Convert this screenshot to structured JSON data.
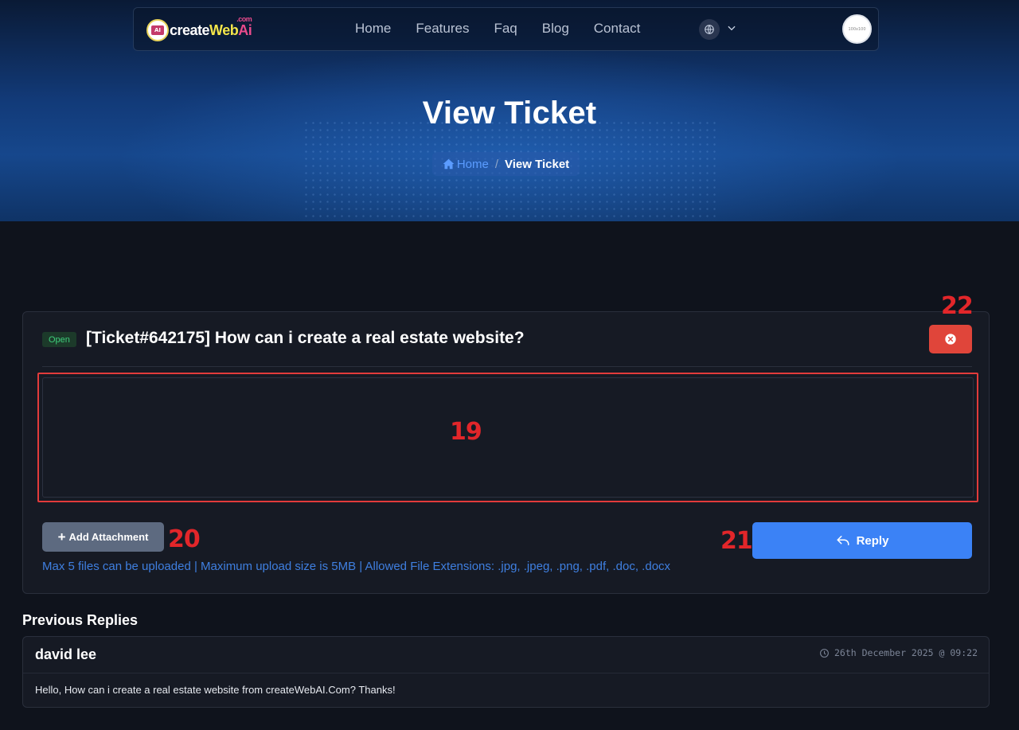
{
  "navbar": {
    "logo": {
      "main": "create",
      "accent": "Web",
      "suffix": "Ai",
      "tld": ".com",
      "badge": "AI"
    },
    "links": [
      "Home",
      "Features",
      "Faq",
      "Blog",
      "Contact"
    ],
    "language_icon": "globe-icon",
    "avatar_text": "100x100"
  },
  "hero": {
    "title": "View Ticket",
    "breadcrumb": {
      "home": "Home",
      "separator": "/",
      "current": "View Ticket"
    }
  },
  "ticket": {
    "status": "Open",
    "title": "[Ticket#642175] How can i create a real estate website?",
    "editor_value": "",
    "add_attachment_label": "Add Attachment",
    "reply_label": "Reply",
    "upload_hint": "Max 5 files can be uploaded | Maximum upload size is 5MB | Allowed File Extensions: .jpg, .jpeg, .png, .pdf, .doc, .docx"
  },
  "annotations": {
    "editor": "19",
    "attach": "20",
    "reply": "21",
    "close": "22"
  },
  "previous_replies": {
    "heading": "Previous Replies",
    "items": [
      {
        "author": "david lee",
        "time": "26th December 2025 @ 09:22",
        "message": "Hello, How can i create a real estate website from createWebAI.Com? Thanks!"
      }
    ]
  },
  "colors": {
    "accent": "#3b82f6",
    "danger": "#e0453a",
    "success": "#3fcf7c",
    "marker": "#e2262a",
    "background": "#0f131c",
    "card": "#161a24"
  }
}
